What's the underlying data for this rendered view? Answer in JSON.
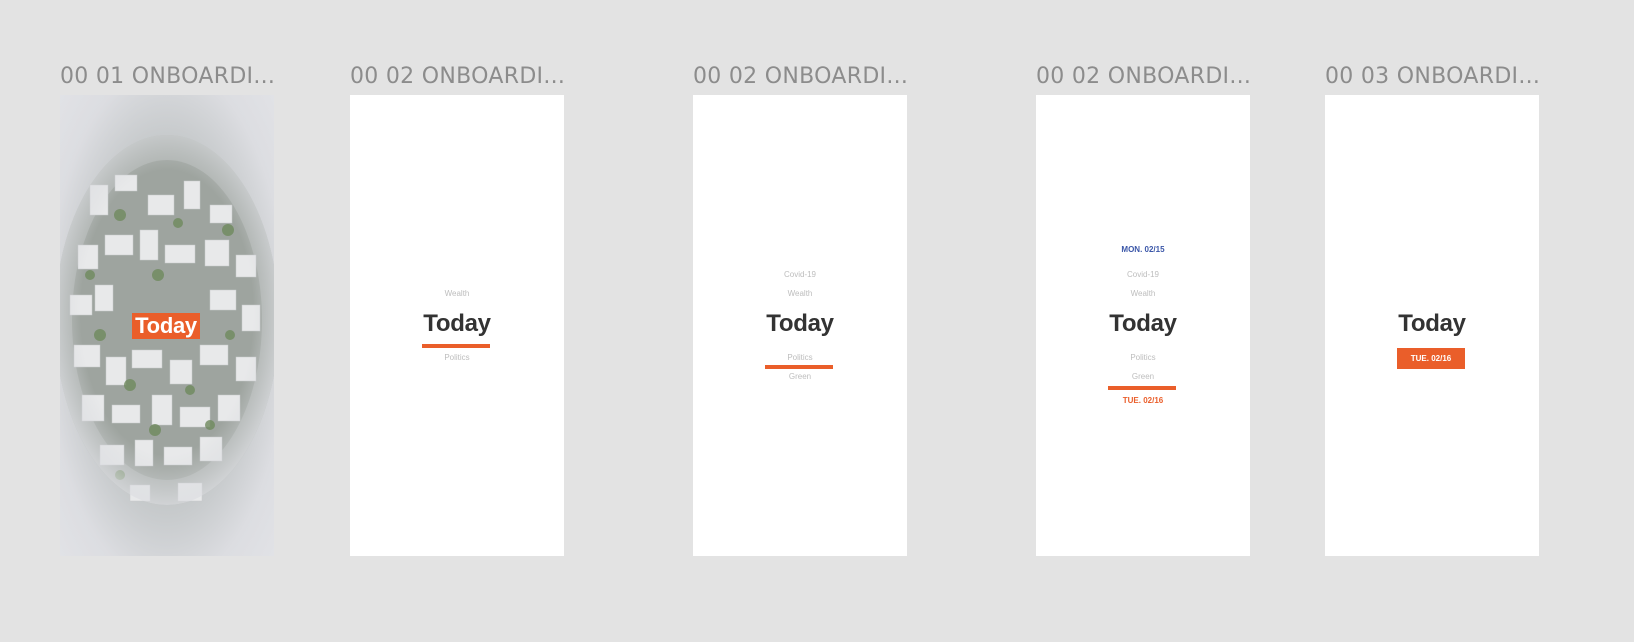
{
  "colors": {
    "canvas": "#e3e3e3",
    "accent": "#ea5e2a",
    "headline": "#333333",
    "muted": "#bdbdbd",
    "date_blue": "#3a56a8",
    "title": "#8c8c8c"
  },
  "frames": [
    {
      "title": "00 01 ONBOARDI...",
      "today": "Today",
      "background": "aerial-city-photo"
    },
    {
      "title": "00 02 ONBOARDI...",
      "above": [
        "Wealth"
      ],
      "today": "Today",
      "below": [
        "Politics"
      ]
    },
    {
      "title": "00 02 ONBOARDI...",
      "above": [
        "Covid-19",
        "Wealth"
      ],
      "today": "Today",
      "below": [
        "Politics",
        "Green"
      ]
    },
    {
      "title": "00 02 ONBOARDI...",
      "top_date": "MON. 02/15",
      "above": [
        "Covid-19",
        "Wealth"
      ],
      "today": "Today",
      "below": [
        "Politics",
        "Green"
      ],
      "bottom_date": "TUE. 02/16"
    },
    {
      "title": "00 03 ONBOARDI...",
      "today": "Today",
      "chip": "TUE. 02/16"
    }
  ]
}
